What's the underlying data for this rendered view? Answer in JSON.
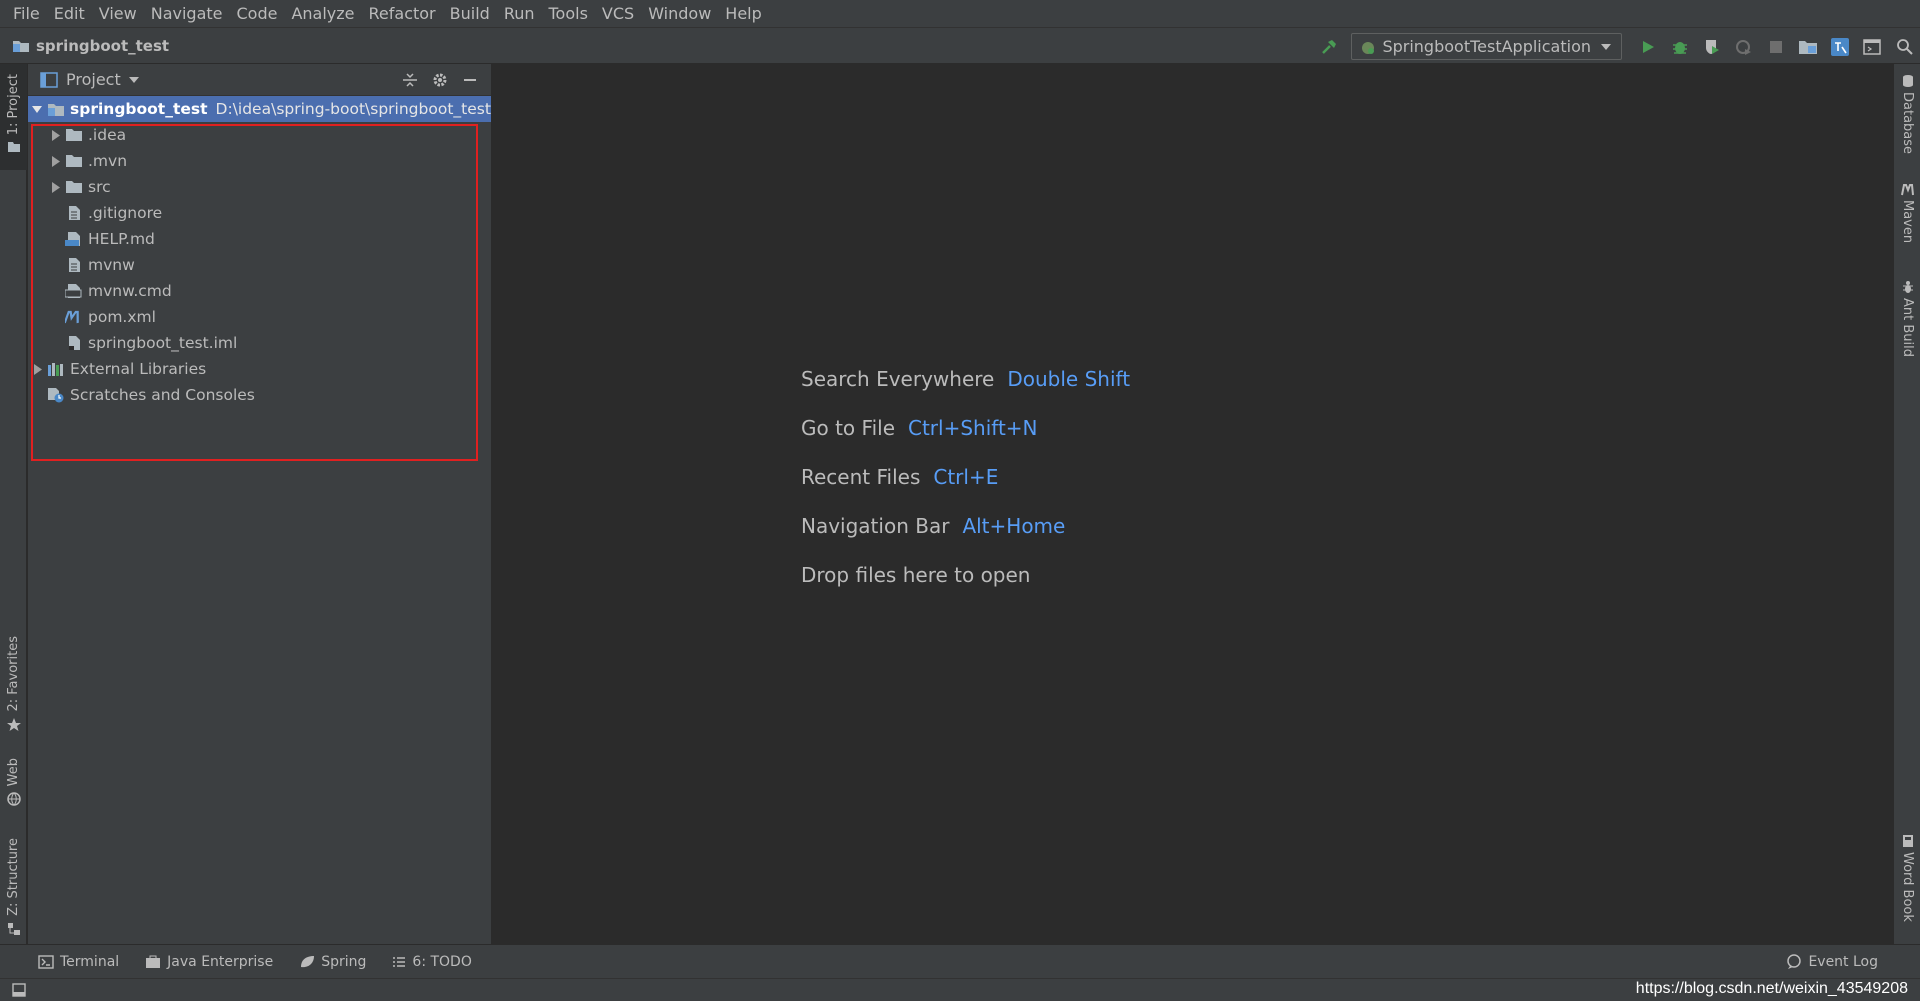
{
  "menu": [
    "File",
    "Edit",
    "View",
    "Navigate",
    "Code",
    "Analyze",
    "Refactor",
    "Build",
    "Run",
    "Tools",
    "VCS",
    "Window",
    "Help"
  ],
  "navbar": {
    "project_crumb": "springboot_test",
    "run_config": "SpringbootTestApplication"
  },
  "left_tabs": {
    "project": "1: Project",
    "favorites": "2: Favorites",
    "web": "Web",
    "structure": "Z: Structure"
  },
  "right_tabs": {
    "database": "Database",
    "maven": "Maven",
    "ant": "Ant Build",
    "wordbook": "Word Book"
  },
  "panel": {
    "title": "Project"
  },
  "tree": {
    "root_name": "springboot_test",
    "root_path": "D:\\idea\\spring-boot\\springboot_test",
    "items": [
      {
        "name": ".idea"
      },
      {
        "name": ".mvn"
      },
      {
        "name": "src"
      },
      {
        "name": ".gitignore"
      },
      {
        "name": "HELP.md"
      },
      {
        "name": "mvnw"
      },
      {
        "name": "mvnw.cmd"
      },
      {
        "name": "pom.xml"
      },
      {
        "name": "springboot_test.iml"
      }
    ],
    "external_libraries": "External Libraries",
    "scratches": "Scratches and Consoles"
  },
  "hints": [
    {
      "label": "Search Everywhere",
      "key": "Double Shift"
    },
    {
      "label": "Go to File",
      "key": "Ctrl+Shift+N"
    },
    {
      "label": "Recent Files",
      "key": "Ctrl+E"
    },
    {
      "label": "Navigation Bar",
      "key": "Alt+Home"
    },
    {
      "label": "Drop files here to open",
      "key": ""
    }
  ],
  "bottom_tabs": {
    "terminal": "Terminal",
    "java_enterprise": "Java Enterprise",
    "spring": "Spring",
    "todo": "6: TODO",
    "event_log": "Event Log"
  },
  "status": {
    "watermark": "https://blog.csdn.net/weixin_43549208"
  },
  "colors": {
    "selection": "#4b6eaf",
    "shortcut": "#589df6",
    "highlight_box": "#e02020",
    "run_green": "#499c54"
  }
}
